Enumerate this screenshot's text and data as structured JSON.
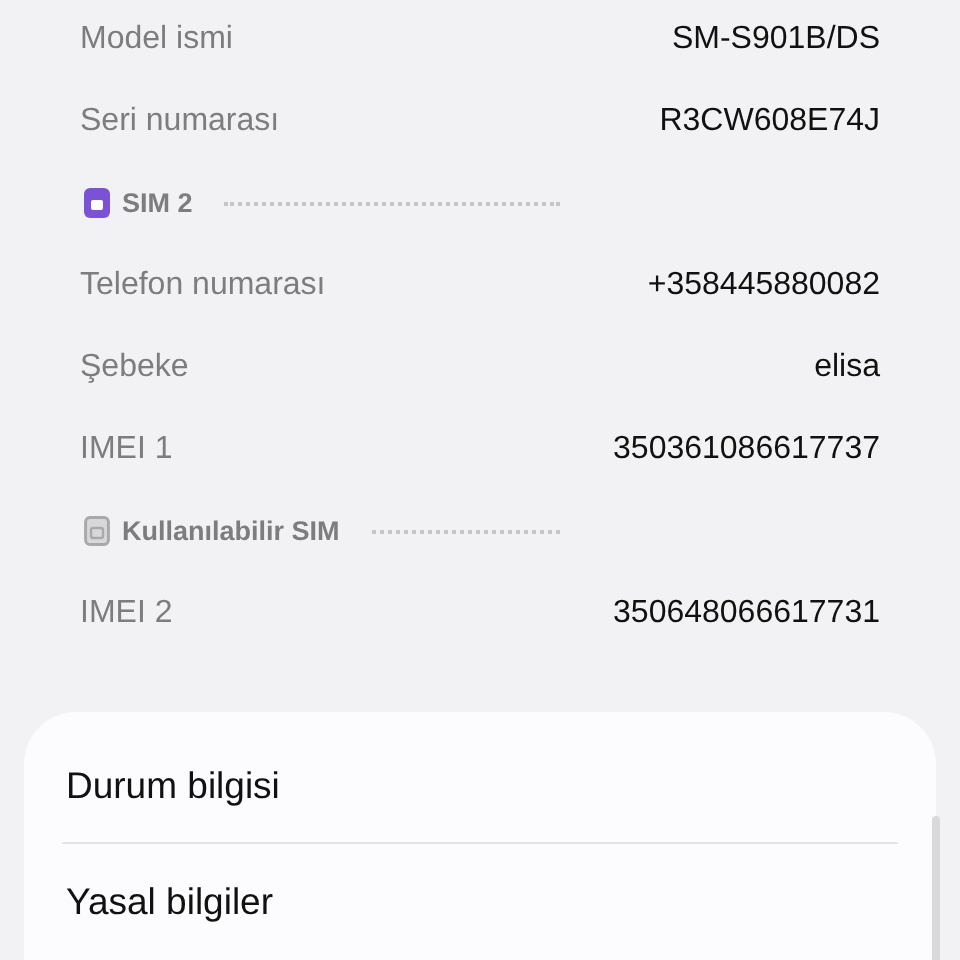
{
  "info_rows": [
    {
      "kind": "row",
      "label": "Model ismi",
      "value": "SM-S901B/DS"
    },
    {
      "kind": "row",
      "label": "Seri numarası",
      "value": "R3CW608E74J"
    },
    {
      "kind": "header",
      "label": "SIM 2",
      "active": true
    },
    {
      "kind": "row",
      "label": "Telefon numarası",
      "value": "+358445880082"
    },
    {
      "kind": "row",
      "label": "Şebeke",
      "value": "elisa"
    },
    {
      "kind": "row",
      "label": "IMEI 1",
      "value": "350361086617737"
    },
    {
      "kind": "header",
      "label": "Kullanılabilir SIM",
      "active": false
    },
    {
      "kind": "row",
      "label": "IMEI 2",
      "value": "350648066617731"
    }
  ],
  "menu_card": {
    "items": [
      "Durum bilgisi",
      "Yasal bilgiler"
    ]
  }
}
